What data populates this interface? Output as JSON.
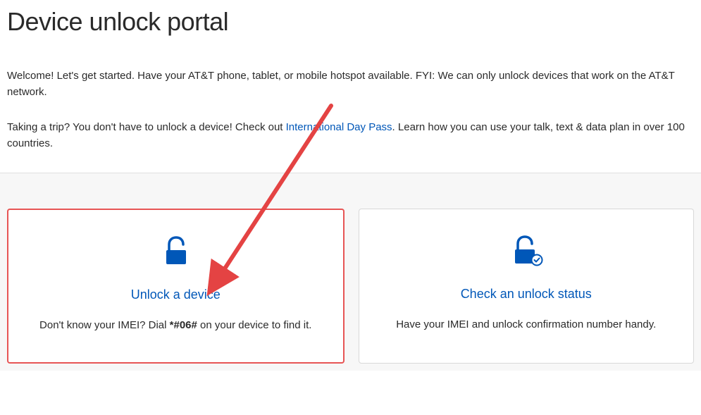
{
  "header": {
    "title": "Device unlock portal"
  },
  "intro": {
    "welcome": "Welcome! Let's get started. Have your AT&T phone, tablet, or mobile hotspot available. FYI: We can only unlock devices that work on the AT&T network.",
    "trip_prefix": "Taking a trip? You don't have to unlock a device! Check out ",
    "trip_link_text": "International Day Pass",
    "trip_suffix": ". Learn how you can use your talk, text & data plan in over 100 countries."
  },
  "cards": {
    "unlock": {
      "title": "Unlock a device",
      "desc_prefix": "Don't know your IMEI? Dial ",
      "desc_code": "*#06#",
      "desc_suffix": " on your device to find it."
    },
    "status": {
      "title": "Check an unlock status",
      "desc": "Have your IMEI and unlock confirmation number handy."
    }
  },
  "annotation": {
    "arrow_color": "#e44343"
  }
}
